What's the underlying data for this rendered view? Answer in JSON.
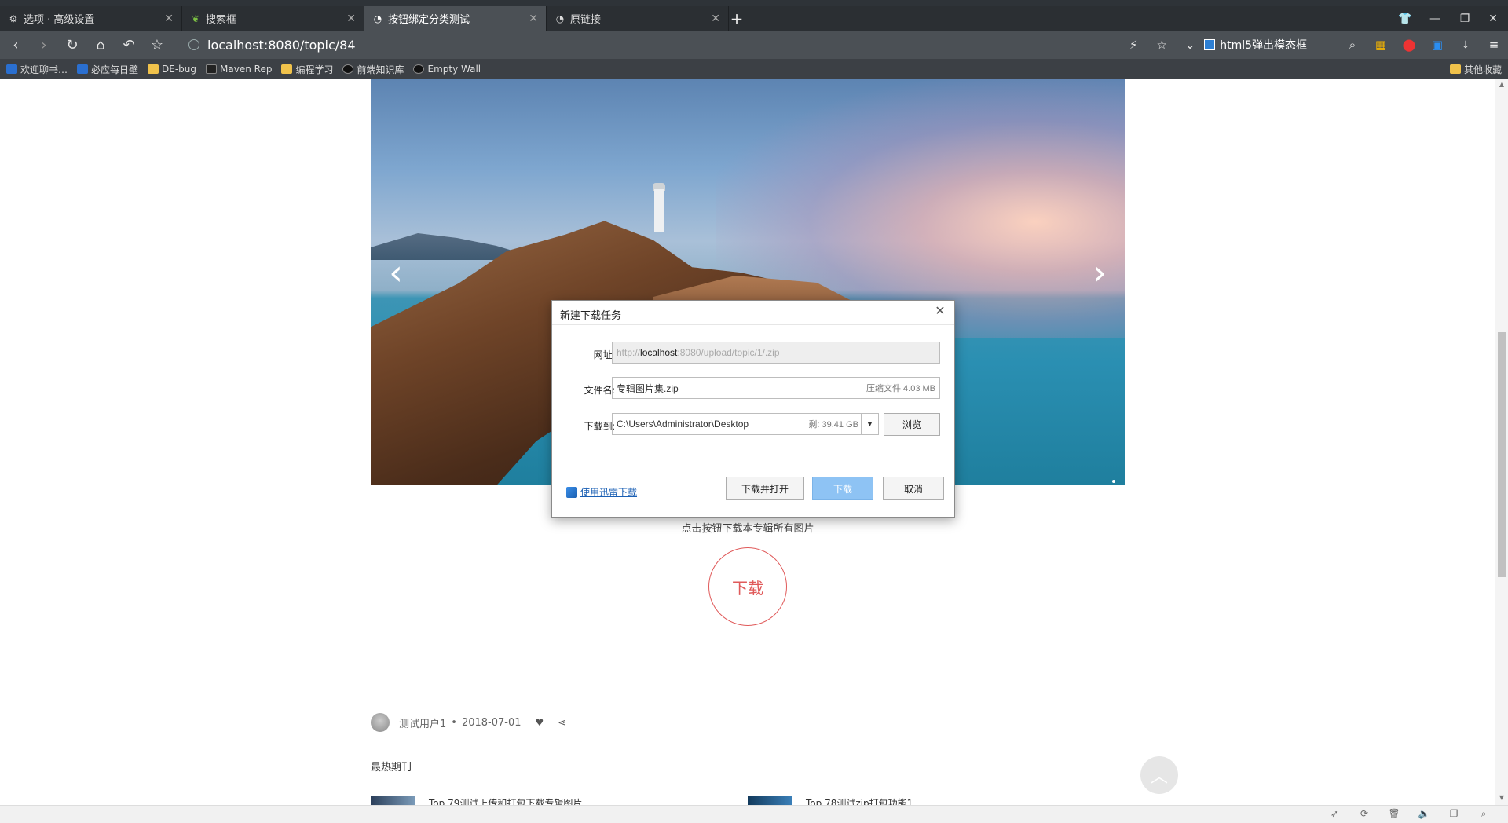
{
  "browser": {
    "tabs": [
      {
        "title": "选项 · 高级设置",
        "icon": "gear-icon"
      },
      {
        "title": "搜索框",
        "icon": "leaf-icon"
      },
      {
        "title": "按钮绑定分类测试",
        "icon": "site-icon"
      },
      {
        "title": "原链接",
        "icon": "site-icon"
      }
    ],
    "address": "localhost:8080/topic/84",
    "quick_link": "html5弹出模态框",
    "bookmarks": [
      {
        "label": "欢迎聊书…",
        "icon": "folder-blue"
      },
      {
        "label": "必应每日壁",
        "icon": "bing-icon"
      },
      {
        "label": "DE-bug",
        "icon": "folder"
      },
      {
        "label": "Maven Rep",
        "icon": "maven-icon"
      },
      {
        "label": "编程学习",
        "icon": "folder"
      },
      {
        "label": "前端知识库",
        "icon": "github-icon"
      },
      {
        "label": "Empty Wall",
        "icon": "github-icon"
      }
    ],
    "bookmarks_right": "其他收藏"
  },
  "page": {
    "hint": "点击按钮下载本专辑所有图片",
    "download_circle": "下载",
    "author": "测试用户1",
    "date": "2018-07-01",
    "hot_title": "最热期刊",
    "hot_items": [
      "Top 79测试上传和打包下载专辑图片",
      "Top 78测试zip打包功能1"
    ]
  },
  "dialog": {
    "title": "新建下载任务",
    "url_label": "网址:",
    "url_prefix": "http://",
    "url_host": "localhost",
    "url_rest": ":8080/upload/topic/1/.zip",
    "filename_label": "文件名:",
    "filename": "专辑图片集.zip",
    "filesize": "压缩文件 4.03 MB",
    "path_label": "下载到:",
    "path": "C:\\Users\\Administrator\\Desktop",
    "free_space": "剩: 39.41 GB",
    "browse": "浏览",
    "thunder": "使用迅雷下载",
    "download_open": "下载并打开",
    "download": "下载",
    "cancel": "取消"
  }
}
